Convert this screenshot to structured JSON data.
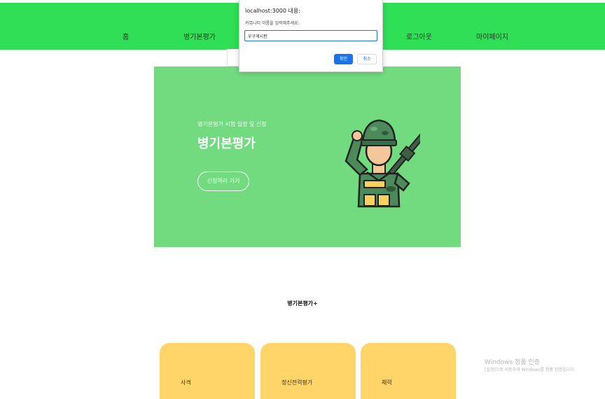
{
  "nav": {
    "items": [
      "홈",
      "병기본평가",
      "로그아웃",
      "마이페이지"
    ]
  },
  "dialog": {
    "title": "localhost:3000 내용:",
    "message": "커뮤니티 이름을 입력해주세요:",
    "input_value": "우구게시판",
    "ok_label": "확인",
    "cancel_label": "취소"
  },
  "hero": {
    "subtitle": "병기본평가 시험 일정 및 신청",
    "title": "병기본평가",
    "button_label": "신청하러 가기"
  },
  "section": {
    "title": "병기본평가+"
  },
  "cards": [
    {
      "label": "사격"
    },
    {
      "label": "정신전력평가"
    },
    {
      "label": "체력"
    }
  ],
  "watermark": {
    "line1": "Windows 정품 인증",
    "line2": "[설정]으로 이동하여 Windows를 정품 인증합니다."
  },
  "colors": {
    "nav_bg": "#2fdf55",
    "hero_bg": "#72db80",
    "card_bg": "#ffd569",
    "dialog_accent": "#1a73e8"
  }
}
